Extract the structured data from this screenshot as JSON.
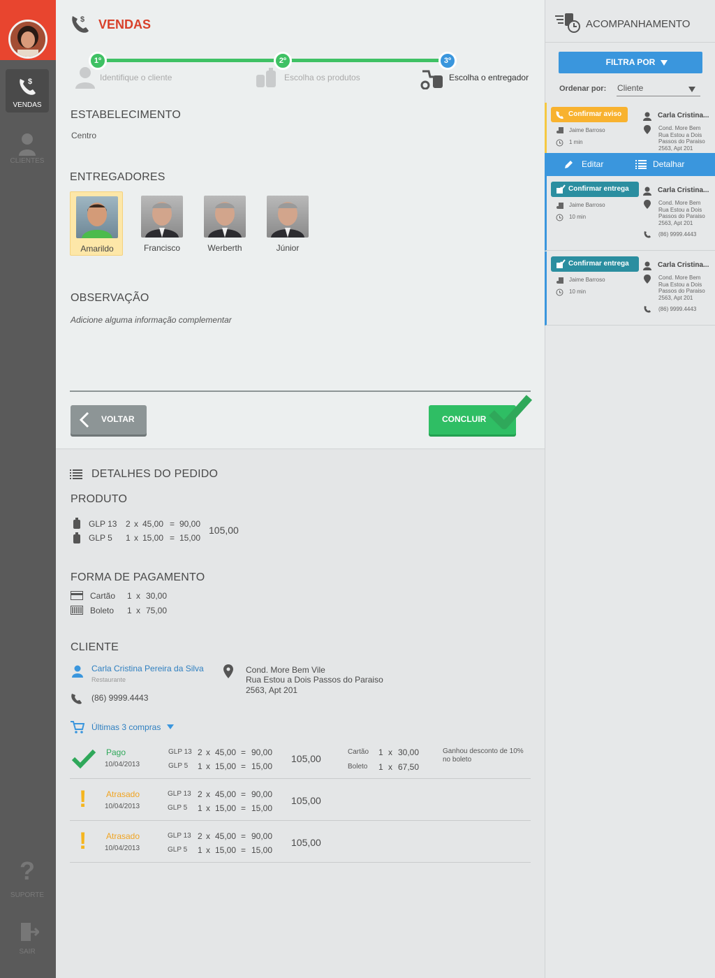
{
  "sidebar": {
    "items": [
      {
        "label": "VENDAS"
      },
      {
        "label": "CLIENTES"
      },
      {
        "label": "SUPORTE"
      },
      {
        "label": "SAIR"
      }
    ]
  },
  "header": {
    "title": "VENDAS"
  },
  "steps": [
    {
      "num": "1º",
      "label": "Identifique o cliente"
    },
    {
      "num": "2º",
      "label": "Escolha os produtos"
    },
    {
      "num": "3º",
      "label": "Escolha o entregador"
    }
  ],
  "estabelecimento": {
    "heading": "ESTABELECIMENTO",
    "value": "Centro"
  },
  "entregadores": {
    "heading": "ENTREGADORES",
    "items": [
      {
        "name": "Amarildo"
      },
      {
        "name": "Francisco"
      },
      {
        "name": "Werberth"
      },
      {
        "name": "Júnior"
      }
    ]
  },
  "observacao": {
    "heading": "OBSERVAÇÃO",
    "placeholder": "Adicione alguma informação complementar"
  },
  "buttons": {
    "back": "VOLTAR",
    "finish": "CONCLUIR"
  },
  "detalhes": {
    "heading": "DETALHES DO PEDIDO",
    "produto": {
      "heading": "PRODUTO",
      "items": [
        {
          "name": "GLP 13",
          "qty": "2",
          "x": "x",
          "price": "45,00",
          "eq": "=",
          "total": "90,00"
        },
        {
          "name": "GLP 5",
          "qty": "1",
          "x": "x",
          "price": "15,00",
          "eq": "=",
          "total": "15,00"
        }
      ],
      "sum": "105,00"
    },
    "pagamento": {
      "heading": "FORMA DE PAGAMENTO",
      "items": [
        {
          "name": "Cartão",
          "qty": "1",
          "x": "x",
          "value": "30,00"
        },
        {
          "name": "Boleto",
          "qty": "1",
          "x": "x",
          "value": "75,00"
        }
      ]
    },
    "cliente": {
      "heading": "CLIENTE",
      "name": "Carla Cristina Pereira da Silva",
      "type": "Restaurante",
      "phone": "(86) 9999.4443",
      "address1": "Cond. More Bem Vile",
      "address2": "Rua Estou a Dois Passos do Paraiso",
      "address3": "2563, Apt 201"
    },
    "ultimas": {
      "label": "Últimas 3 compras",
      "rows": [
        {
          "status": "Pago",
          "date": "10/04/2013",
          "lines": [
            {
              "name": "GLP 13",
              "qty": "2",
              "x": "x",
              "price": "45,00",
              "eq": "=",
              "total": "90,00"
            },
            {
              "name": "GLP 5",
              "qty": "1",
              "x": "x",
              "price": "15,00",
              "eq": "=",
              "total": "15,00"
            }
          ],
          "sum": "105,00",
          "pay": [
            {
              "name": "Cartão",
              "qty": "1",
              "x": "x",
              "value": "30,00"
            },
            {
              "name": "Boleto",
              "qty": "1",
              "x": "x",
              "value": "67,50"
            }
          ],
          "note": "Ganhou desconto de 10% no boleto"
        },
        {
          "status": "Atrasado",
          "date": "10/04/2013",
          "lines": [
            {
              "name": "GLP 13",
              "qty": "2",
              "x": "x",
              "price": "45,00",
              "eq": "=",
              "total": "90,00"
            },
            {
              "name": "GLP 5",
              "qty": "1",
              "x": "x",
              "price": "15,00",
              "eq": "=",
              "total": "15,00"
            }
          ],
          "sum": "105,00"
        },
        {
          "status": "Atrasado",
          "date": "10/04/2013",
          "lines": [
            {
              "name": "GLP 13",
              "qty": "2",
              "x": "x",
              "price": "45,00",
              "eq": "=",
              "total": "90,00"
            },
            {
              "name": "GLP 5",
              "qty": "1",
              "x": "x",
              "price": "15,00",
              "eq": "=",
              "total": "15,00"
            }
          ],
          "sum": "105,00"
        }
      ]
    }
  },
  "panel": {
    "title": "ACOMPANHAMENTO",
    "filter": "FILTRA POR",
    "sort_label": "Ordenar por:",
    "sort_value": "Cliente",
    "actions": {
      "edit": "Editar",
      "detail": "Detalhar"
    },
    "cards": [
      {
        "tag": "Confirmar aviso",
        "who": "Jaime Barroso",
        "time": "1 min",
        "client": "Carla Cristina...",
        "addr": [
          "Cond. More Bem",
          "Rua Estou a Dois",
          "Passos do Paraiso",
          "2563, Apt 201"
        ],
        "phone": ""
      },
      {
        "tag": "Confirmar entrega",
        "who": "Jaime Barroso",
        "time": "10 min",
        "client": "Carla Cristina...",
        "addr": [
          "Cond. More Bem",
          "Rua Estou a Dois",
          "Passos do Paraiso",
          "2563, Apt 201"
        ],
        "phone": "(86) 9999.4443"
      },
      {
        "tag": "Confirmar entrega",
        "who": "Jaime Barroso",
        "time": "10 min",
        "client": "Carla Cristina...",
        "addr": [
          "Cond. More Bem",
          "Rua Estou a Dois",
          "Passos do Paraiso",
          "2563, Apt 201"
        ],
        "phone": "(86) 9999.4443"
      }
    ]
  },
  "colors": {
    "accent": "#3a96dd",
    "brand": "#d8402a",
    "success": "#2fbe64",
    "warning": "#f0a422"
  }
}
